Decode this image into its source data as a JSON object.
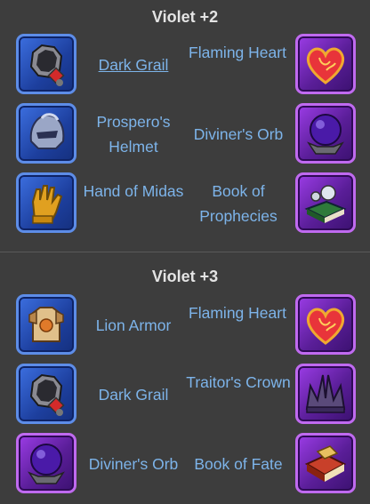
{
  "sections": [
    {
      "title": "Violet +2",
      "rows": [
        {
          "left": {
            "label": "Dark Grail",
            "icon": "dark-grail-icon",
            "frame": "blue"
          },
          "right": {
            "label": "Flaming Heart",
            "icon": "flaming-heart-icon",
            "frame": "purple"
          }
        },
        {
          "left": {
            "label": "Prospero's Helmet",
            "icon": "prosperos-helmet-icon",
            "frame": "blue"
          },
          "right": {
            "label": "Diviner's Orb",
            "icon": "diviners-orb-icon",
            "frame": "purple"
          }
        },
        {
          "left": {
            "label": "Hand of Midas",
            "icon": "hand-of-midas-icon",
            "frame": "blue"
          },
          "right": {
            "label": "Book of Prophecies",
            "icon": "book-of-prophecies-icon",
            "frame": "purple"
          }
        }
      ]
    },
    {
      "title": "Violet +3",
      "rows": [
        {
          "left": {
            "label": "Lion Armor",
            "icon": "lion-armor-icon",
            "frame": "blue"
          },
          "right": {
            "label": "Flaming Heart",
            "icon": "flaming-heart-icon",
            "frame": "purple"
          }
        },
        {
          "left": {
            "label": "Dark Grail",
            "icon": "dark-grail-icon",
            "frame": "blue"
          },
          "right": {
            "label": "Traitor's Crown",
            "icon": "traitors-crown-icon",
            "frame": "purple"
          }
        },
        {
          "left": {
            "label": "Diviner's Orb",
            "icon": "diviners-orb-icon",
            "frame": "purple"
          },
          "right": {
            "label": "Book of Fate",
            "icon": "book-of-fate-icon",
            "frame": "purple"
          }
        }
      ]
    }
  ],
  "colors": {
    "background": "#3d3d3d",
    "title": "#e4e4e4",
    "link": "#7db4ea",
    "blue_frame": "#5d8de8",
    "purple_frame": "#c06af0"
  }
}
